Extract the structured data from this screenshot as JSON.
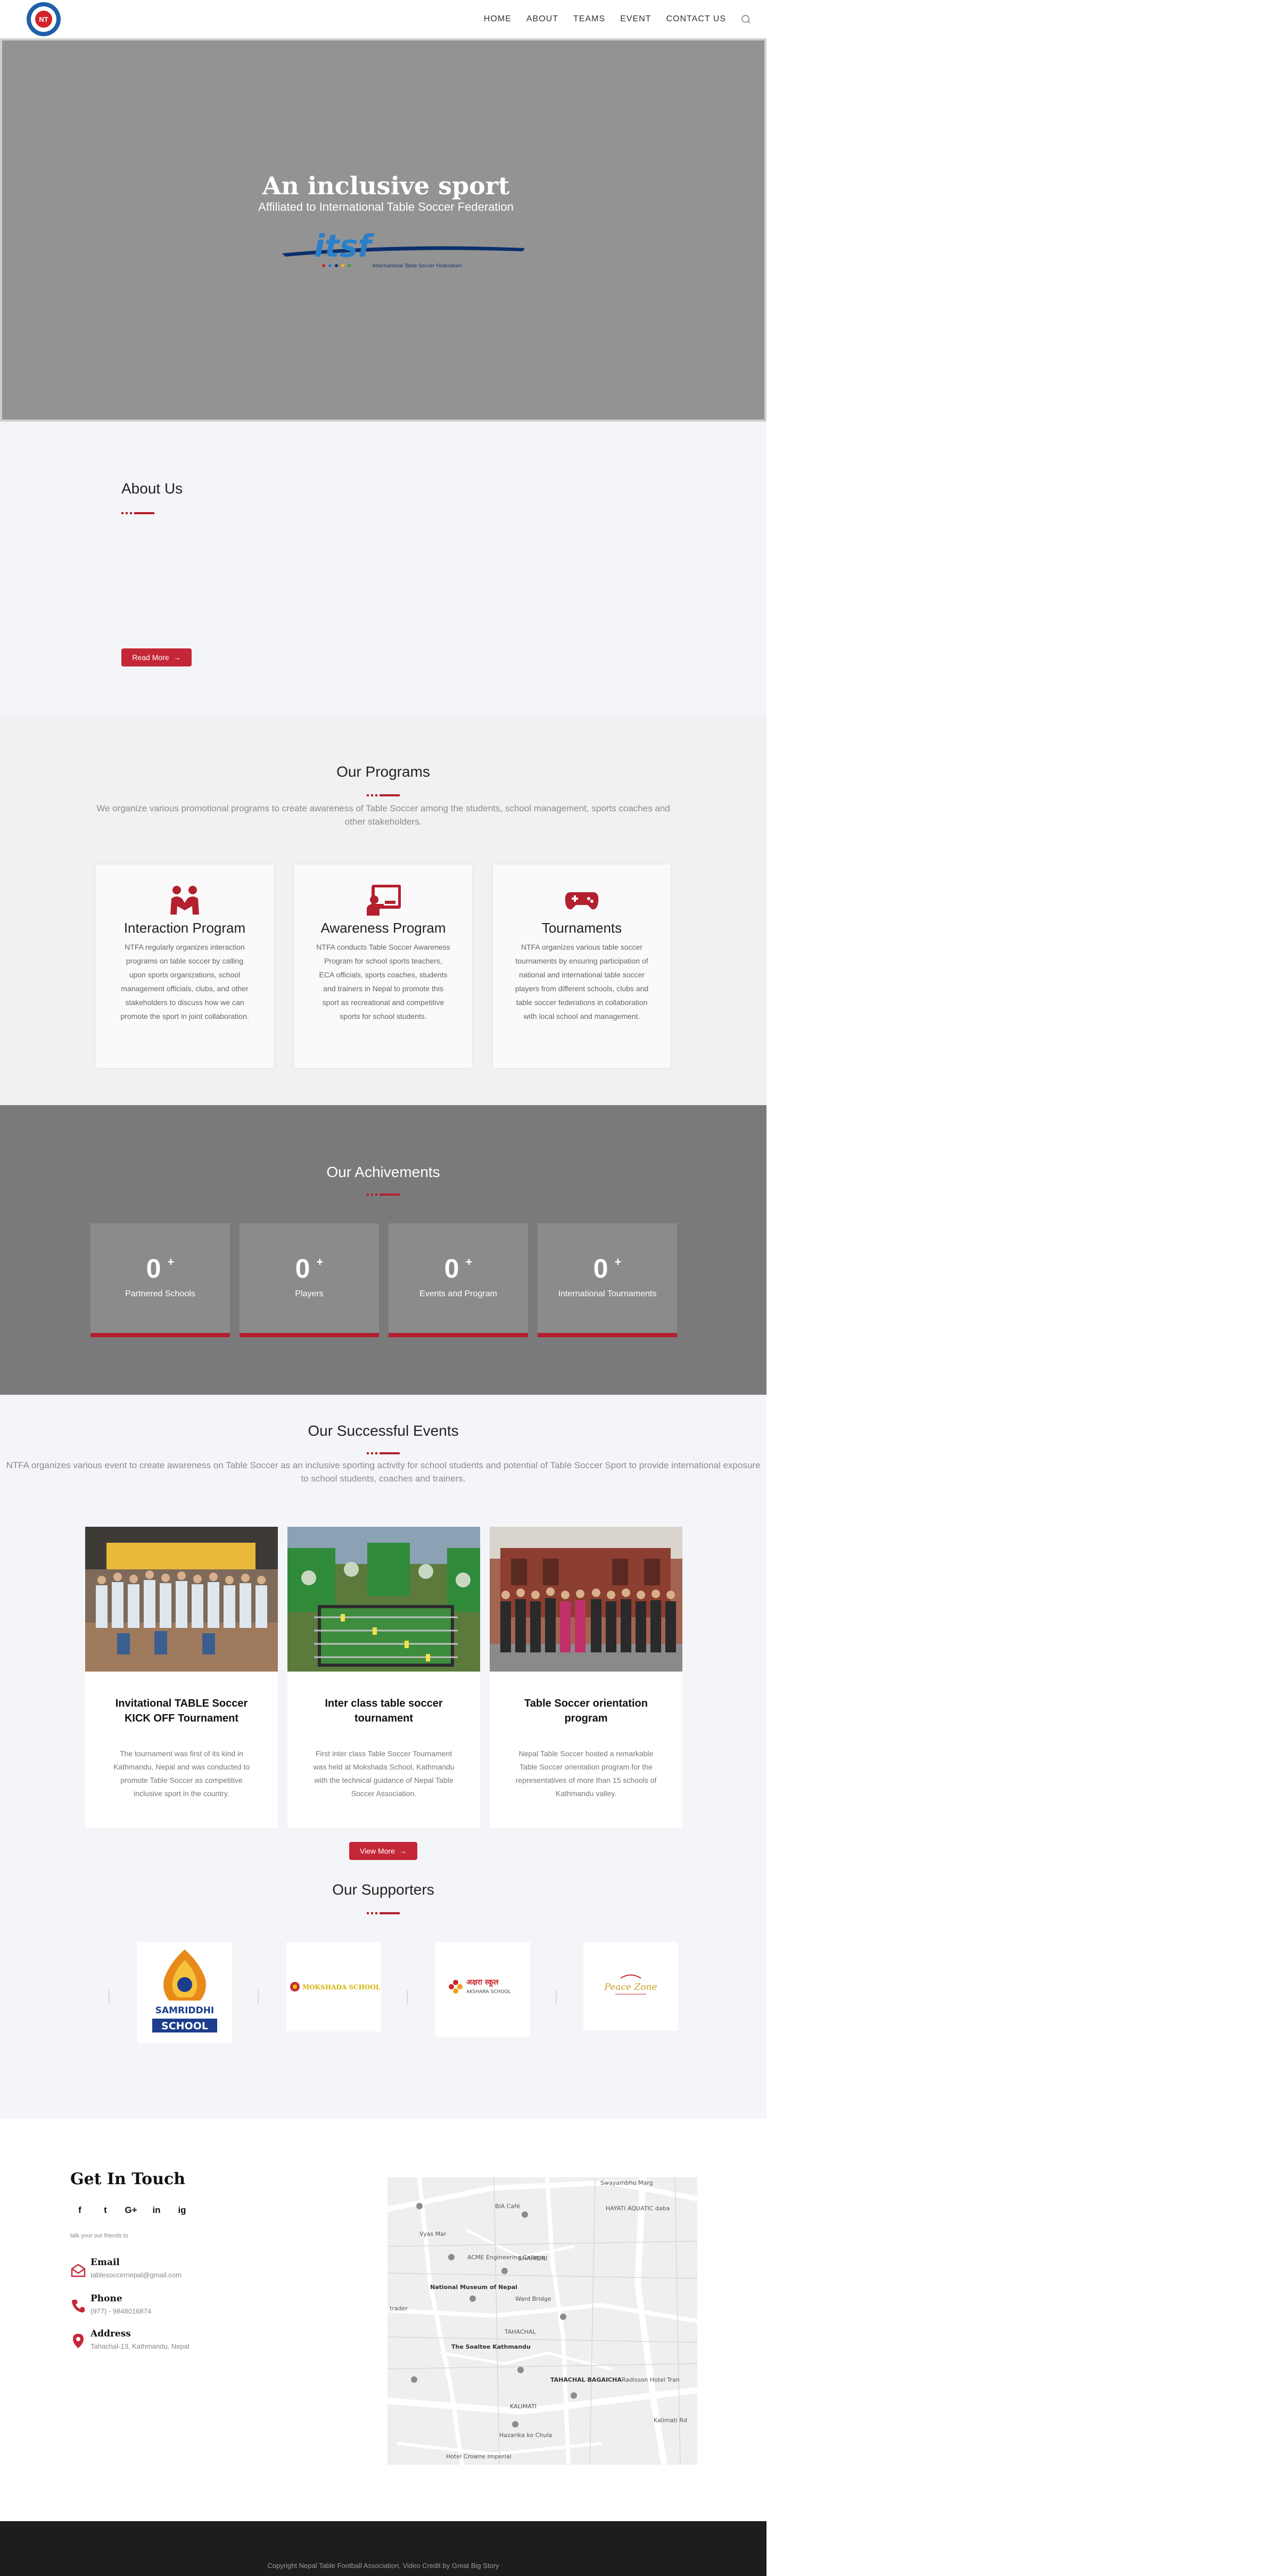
{
  "header": {
    "logo_text": "NT",
    "nav": [
      "HOME",
      "ABOUT",
      "TEAMS",
      "EVENT",
      "CONTACT US"
    ]
  },
  "hero": {
    "title": "An inclusive sport",
    "subtitle": "Affiliated to International Table Soccer Federation",
    "logo_text": "itsf",
    "logo_tagline": "International Table Soccer Federation"
  },
  "about": {
    "title": "About Us",
    "button": "Read More"
  },
  "programs": {
    "title": "Our Programs",
    "description": "We organize various promotional programs to create awareness of Table Soccer among the students, school management, sports coaches and other stakeholders.",
    "items": [
      {
        "title": "Interaction Program",
        "icon": "people-handshake-icon",
        "description": "NTFA regularly organizes interaction programs on table soccer by calling upon sports organizations, school management officials, clubs, and other stakeholders to discuss how we can promote the sport in joint collaboration."
      },
      {
        "title": "Awareness Program",
        "icon": "presenter-board-icon",
        "description": "NTFA conducts Table Soccer Awareness Program for school sports teachers, ECA officials, sports coaches, students and trainers in Nepal to promote this sport as recreational and competitive sports for school students."
      },
      {
        "title": "Tournaments",
        "icon": "gamepad-icon",
        "description": "NTFA organizes various table soccer tournaments by ensuring participation of national and international table soccer players from different schools, clubs and table soccer federations in collaboration with local school and management."
      }
    ]
  },
  "achievements": {
    "title": "Our Achivements",
    "items": [
      {
        "value": "0",
        "suffix": "+",
        "label": "Partnered Schools"
      },
      {
        "value": "0",
        "suffix": "+",
        "label": "Players"
      },
      {
        "value": "0",
        "suffix": "+",
        "label": "Events and Program"
      },
      {
        "value": "0",
        "suffix": "+",
        "label": "International Tournaments"
      }
    ]
  },
  "events": {
    "title": "Our Successful Events",
    "description": "NTFA organizes various event to create awareness on Table Soccer as an inclusive sporting activity for school students and potential of  Table Soccer Sport to provide international exposure to school  students, coaches and trainers.",
    "items": [
      {
        "title": "Invitational TABLE Soccer KICK OFF Tournament",
        "description": "The tournament was first of its kind in Kathmandu, Nepal and was conducted to promote Table Soccer as competitive inclusive sport in the country."
      },
      {
        "title": "Inter class table soccer tournament",
        "description": "First inter class Table Soccer Tournament was held at Mokshada School, Kathmandu with the technical guidance of Nepal Table Soccer Association."
      },
      {
        "title": "Table Soccer orientation program",
        "description": "Nepal Table Soccer hosted a remarkable Table Soccer orientation program for the representatives of more than 15 schools of Kathmandu valley."
      }
    ],
    "button": "View More"
  },
  "supporters": {
    "title": "Our Supporters",
    "items": [
      {
        "name": "SAMRIDDHI SCHOOL",
        "line1": "SAMRIDDHI",
        "line2": "SCHOOL"
      },
      {
        "name": "MOKSHADA SCHOOL",
        "line1": "MOKSHADA SCHOOL"
      },
      {
        "name": "AKSHARA SCHOOL",
        "line1": "अक्षरा स्कूल",
        "line2": "AKSHARA SCHOOL"
      },
      {
        "name": "Peace Zone",
        "line1": "Peace Zone"
      }
    ]
  },
  "contact": {
    "title": "Get In Touch",
    "tagline": "talk your our friends to",
    "socials": [
      "f",
      "t",
      "G+",
      "in",
      "ig"
    ],
    "email_label": "Email",
    "email": "tablesoccernepal@gmail.com",
    "phone_label": "Phone",
    "phone": "(977) - 9848016874",
    "address_label": "Address",
    "address": "Tahachal-13, Kathmandu, Nepal"
  },
  "map": {
    "labels": [
      "Swayambhu Marg",
      "HAYATI AQUATIC daba",
      "BIA Café",
      "ACME Engineering College",
      "SHAHIDNI",
      "National Museum of Nepal",
      "Ward Bridge",
      "Vyas Mar",
      "TAHACHAL",
      "The Soaltee Kathmandu",
      "Radisson Hotel Tran",
      "TAHACHAL BAGAICHA",
      "KALIMATI",
      "Hazarika ko Chula",
      "Hotel Crowne Imperial",
      "Kalimati Rd",
      "trader"
    ]
  },
  "footer": {
    "text": "Copyright Nepal Table Football Association, Video Credit by Great Big Story"
  },
  "colors": {
    "accent": "#b3202f",
    "hero_bg": "#939393",
    "achievements_bg": "#7a7a7a",
    "footer_bg": "#1d1d1d"
  }
}
